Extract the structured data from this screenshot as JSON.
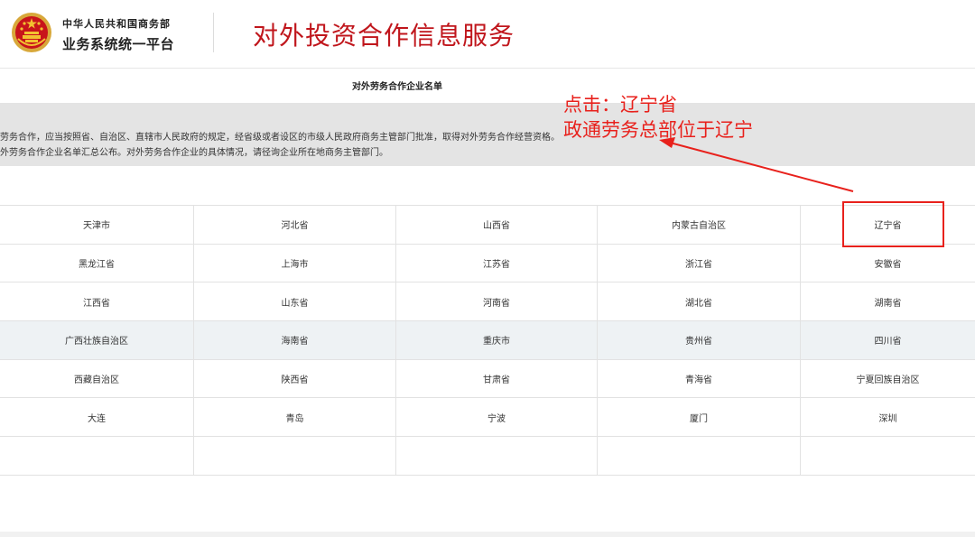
{
  "header": {
    "org_line1": "中华人民共和国商务部",
    "org_line2": "业务系统统一平台",
    "site_title": "对外投资合作信息服务",
    "emblem_icon": "national-emblem-icon"
  },
  "notice": {
    "list_title": "对外劳务合作企业名单",
    "line1": "劳务合作，应当按照省、自治区、直辖市人民政府的规定，经省级或者设区的市级人民政府商务主管部门批准，取得对外劳务合作经营资格。",
    "line2": "外劳务合作企业名单汇总公布。对外劳务合作企业的具体情况，请径询企业所在地商务主管部门。"
  },
  "regions": [
    [
      "天津市",
      "河北省",
      "山西省",
      "内蒙古自治区",
      "辽宁省"
    ],
    [
      "黑龙江省",
      "上海市",
      "江苏省",
      "浙江省",
      "安徽省"
    ],
    [
      "江西省",
      "山东省",
      "河南省",
      "湖北省",
      "湖南省"
    ],
    [
      "广西壮族自治区",
      "海南省",
      "重庆市",
      "贵州省",
      "四川省"
    ],
    [
      "西藏自治区",
      "陕西省",
      "甘肃省",
      "青海省",
      "宁夏回族自治区"
    ],
    [
      "大连",
      "青岛",
      "宁波",
      "厦门",
      "深圳"
    ],
    [
      "",
      "",
      "",
      "",
      ""
    ]
  ],
  "annotation": {
    "line1": "点击：辽宁省",
    "line2": "政通劳务总部位于辽宁",
    "color": "#e8211c"
  },
  "colors": {
    "brand_red": "#c0161c",
    "notice_bg": "#e4e4e4",
    "highlight_row": "#eef2f4"
  }
}
